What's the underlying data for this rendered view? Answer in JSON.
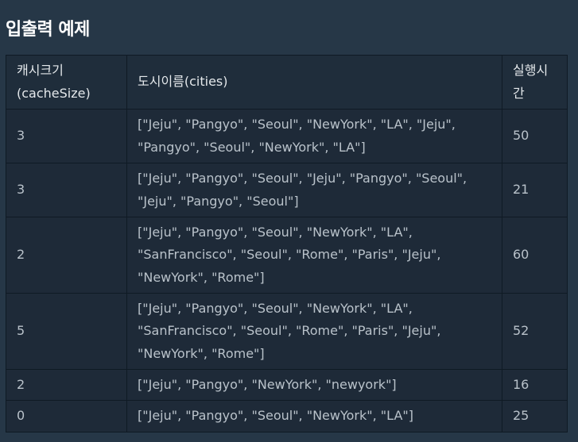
{
  "section": {
    "title": "입출력 예제"
  },
  "table": {
    "headers": [
      "캐시크기(cacheSize)",
      "도시이름(cities)",
      "실행시간"
    ],
    "rows": [
      {
        "cache_size": "3",
        "cities": "[\"Jeju\", \"Pangyo\", \"Seoul\", \"NewYork\", \"LA\", \"Jeju\", \"Pangyo\", \"Seoul\", \"NewYork\", \"LA\"]",
        "time": "50"
      },
      {
        "cache_size": "3",
        "cities": "[\"Jeju\", \"Pangyo\", \"Seoul\", \"Jeju\", \"Pangyo\", \"Seoul\", \"Jeju\", \"Pangyo\", \"Seoul\"]",
        "time": "21"
      },
      {
        "cache_size": "2",
        "cities": "[\"Jeju\", \"Pangyo\", \"Seoul\", \"NewYork\", \"LA\", \"SanFrancisco\", \"Seoul\", \"Rome\", \"Paris\", \"Jeju\", \"NewYork\", \"Rome\"]",
        "time": "60"
      },
      {
        "cache_size": "5",
        "cities": "[\"Jeju\", \"Pangyo\", \"Seoul\", \"NewYork\", \"LA\", \"SanFrancisco\", \"Seoul\", \"Rome\", \"Paris\", \"Jeju\", \"NewYork\", \"Rome\"]",
        "time": "52"
      },
      {
        "cache_size": "2",
        "cities": "[\"Jeju\", \"Pangyo\", \"NewYork\", \"newyork\"]",
        "time": "16"
      },
      {
        "cache_size": "0",
        "cities": "[\"Jeju\", \"Pangyo\", \"Seoul\", \"NewYork\", \"LA\"]",
        "time": "25"
      }
    ]
  },
  "colors": {
    "page_background": "#263747",
    "table_background": "#1e2a38",
    "border": "#0f1a24",
    "heading_text": "#ffffff",
    "cell_text": "#b9c2ca"
  }
}
